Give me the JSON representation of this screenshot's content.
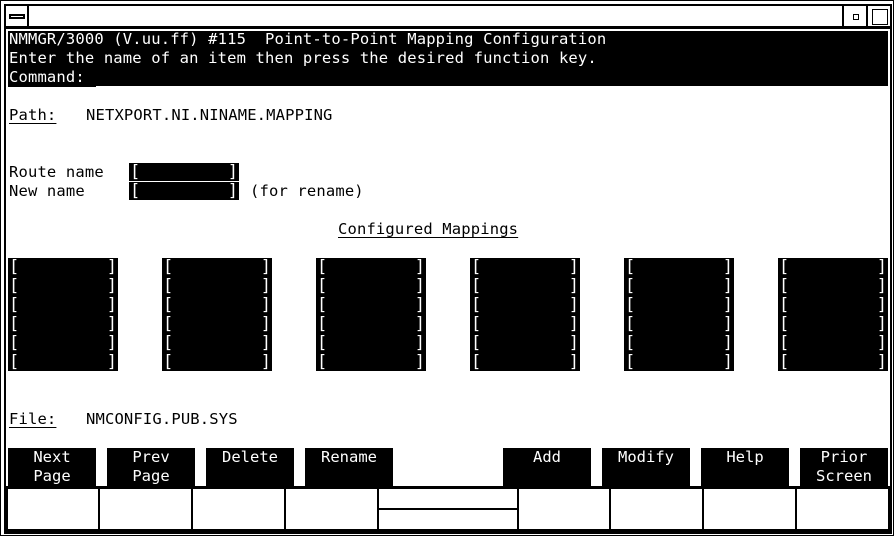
{
  "window": {
    "system_menu_icon": "system-menu-icon",
    "minimize_icon": "minimize-icon",
    "maximize_icon": "maximize-icon"
  },
  "header": {
    "title_line": "NMMGR/3000 (V.uu.ff) #115  Point-to-Point Mapping Configuration",
    "instruction_line": "Enter the name of an item then press the desired function key.",
    "command_label": "Command:"
  },
  "path": {
    "label": "Path:",
    "value": "NETXPORT.NI.NINAME.MAPPING"
  },
  "form": {
    "route_name_label": "Route name",
    "route_name_value": "",
    "new_name_label": "New name",
    "new_name_value": "",
    "new_name_hint": "(for rename)",
    "bracket_open": "[",
    "bracket_close": "]"
  },
  "mappings": {
    "title": "Configured Mappings",
    "columns": [
      {
        "entries": [
          "",
          "",
          "",
          "",
          "",
          ""
        ]
      },
      {
        "entries": [
          "",
          "",
          "",
          "",
          "",
          ""
        ]
      },
      {
        "entries": [
          "",
          "",
          "",
          "",
          "",
          ""
        ]
      },
      {
        "entries": [
          "",
          "",
          "",
          "",
          "",
          ""
        ]
      },
      {
        "entries": [
          "",
          "",
          "",
          "",
          "",
          ""
        ]
      },
      {
        "entries": [
          "",
          "",
          "",
          "",
          "",
          ""
        ]
      }
    ]
  },
  "file": {
    "label": "File:",
    "value": "NMCONFIG.PUB.SYS"
  },
  "function_keys": [
    {
      "line1": "Next",
      "line2": "Page"
    },
    {
      "line1": "Prev",
      "line2": "Page"
    },
    {
      "line1": "Delete",
      "line2": ""
    },
    {
      "line1": "Rename",
      "line2": ""
    },
    {
      "line1": "",
      "line2": ""
    },
    {
      "line1": "Add",
      "line2": ""
    },
    {
      "line1": "Modify",
      "line2": ""
    },
    {
      "line1": "Help",
      "line2": ""
    },
    {
      "line1": "Prior",
      "line2": "Screen"
    }
  ]
}
